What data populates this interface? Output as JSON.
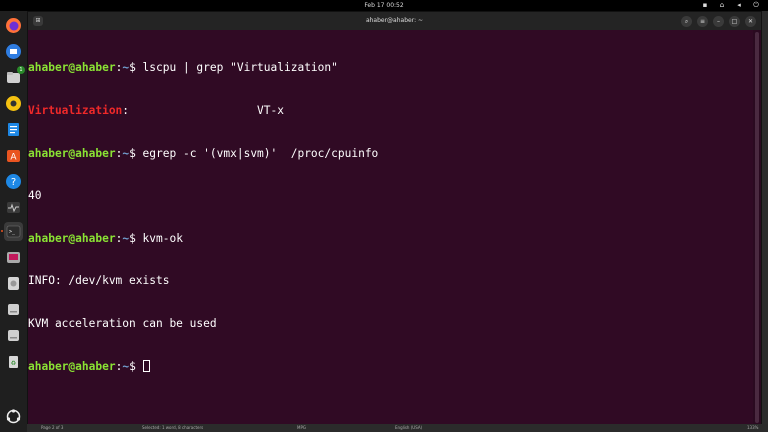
{
  "topbar": {
    "clock": "Feb 17  00:52"
  },
  "window": {
    "title": "ahaber@ahaber: ~"
  },
  "prompt": {
    "user": "ahaber@ahaber",
    "sep": ":",
    "path": "~",
    "symbol": "$ "
  },
  "terminal": {
    "cmd1": "lscpu | grep \"Virtualization\"",
    "out1_key": "Virtualization",
    "out1_rest": ":                   VT-x",
    "cmd2": "egrep -c '(vmx|svm)'  /proc/cpuinfo",
    "out2": "40",
    "cmd3": "kvm-ok",
    "out3a": "INFO: /dev/kvm exists",
    "out3b": "KVM acceleration can be used"
  },
  "dock": {
    "items": [
      "firefox-icon",
      "thunderbird-icon",
      "files-icon",
      "rhythmbox-icon",
      "writer-icon",
      "software-icon",
      "help-icon",
      "system-monitor-icon",
      "terminal-icon",
      "screenshot-icon",
      "disk-icon",
      "drive-icon",
      "drive-icon",
      "trash-icon",
      "apps-grid-icon"
    ],
    "files_badge": "1"
  },
  "statusbar": {
    "page": "Page 2 of 3",
    "selection": "Selected: 1 word, 8 characters",
    "style": "MPG",
    "lang": "English (USA)",
    "zoom": "133%"
  }
}
